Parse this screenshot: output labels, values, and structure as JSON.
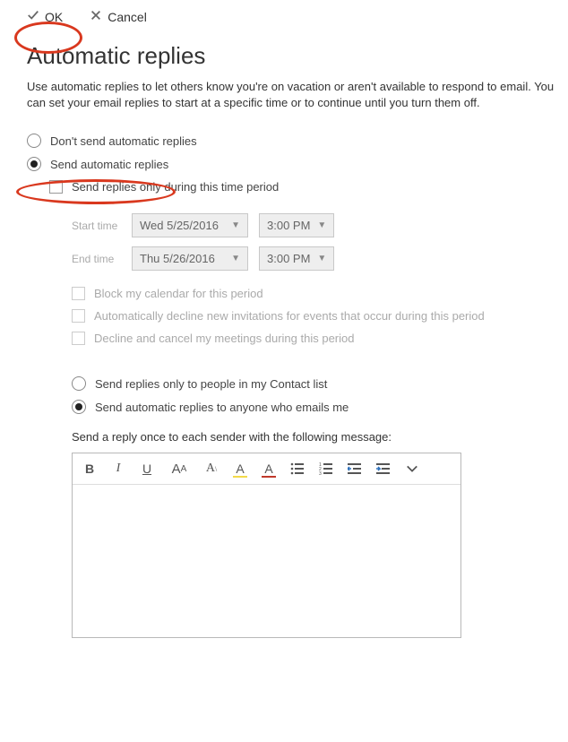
{
  "toolbar": {
    "ok_label": "OK",
    "cancel_label": "Cancel"
  },
  "title": "Automatic replies",
  "description": "Use automatic replies to let others know you're on vacation or aren't available to respond to email. You can set your email replies to start at a specific time or to continue until you turn them off.",
  "options": {
    "dont_send": "Don't send automatic replies",
    "send": "Send automatic replies",
    "time_period": "Send replies only during this time period",
    "start_label": "Start time",
    "start_date": "Wed 5/25/2016",
    "start_time": "3:00 PM",
    "end_label": "End time",
    "end_date": "Thu 5/26/2016",
    "end_time": "3:00 PM",
    "block_calendar": "Block my calendar for this period",
    "decline_new": "Automatically decline new invitations for events that occur during this period",
    "decline_cancel": "Decline and cancel my meetings during this period",
    "contacts_only": "Send replies only to people in my Contact list",
    "anyone": "Send automatic replies to anyone who emails me",
    "message_label": "Send a reply once to each sender with the following message:"
  },
  "editor": {
    "bold": "B",
    "italic": "I",
    "underline": "U",
    "fontsize_big": "A",
    "fontsize_small": "A",
    "highlight": "A",
    "fontcolor": "A"
  }
}
